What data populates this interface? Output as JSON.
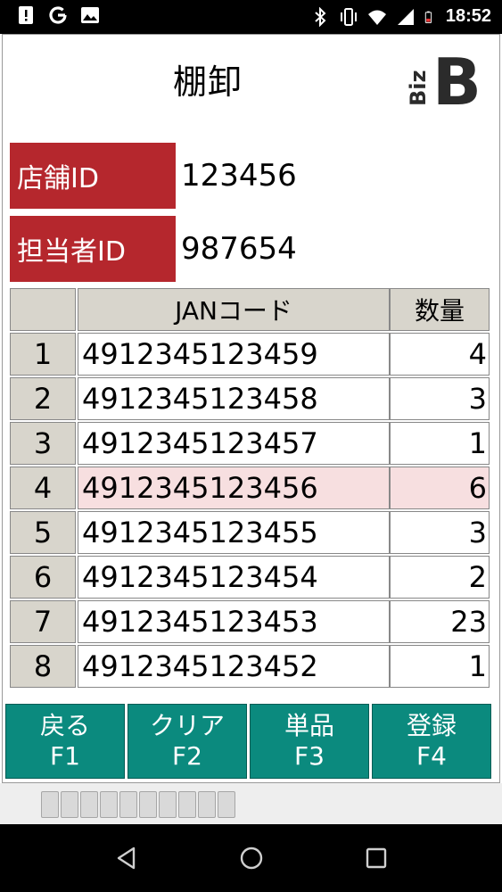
{
  "status_bar": {
    "time": "18:52",
    "left_icons": [
      "alert-icon",
      "google-icon",
      "image-icon"
    ],
    "right_icons": [
      "bluetooth-icon",
      "vibrate-icon",
      "wifi-icon",
      "signal-icon",
      "battery-icon"
    ]
  },
  "header": {
    "title": "棚卸",
    "logo_text": "Biz",
    "logo_letter": "B"
  },
  "fields": {
    "store_label": "店舗ID",
    "store_value": "123456",
    "staff_label": "担当者ID",
    "staff_value": "987654"
  },
  "table": {
    "columns": [
      "",
      "JANコード",
      "数量"
    ],
    "selected_row": 4,
    "rows": [
      {
        "no": "1",
        "jan": "4912345123459",
        "qty": "4"
      },
      {
        "no": "2",
        "jan": "4912345123458",
        "qty": "3"
      },
      {
        "no": "3",
        "jan": "4912345123457",
        "qty": "1"
      },
      {
        "no": "4",
        "jan": "4912345123456",
        "qty": "6"
      },
      {
        "no": "5",
        "jan": "4912345123455",
        "qty": "3"
      },
      {
        "no": "6",
        "jan": "4912345123454",
        "qty": "2"
      },
      {
        "no": "7",
        "jan": "4912345123453",
        "qty": "23"
      },
      {
        "no": "8",
        "jan": "4912345123452",
        "qty": "1"
      }
    ]
  },
  "buttons": [
    {
      "label": "戻る",
      "key": "F1"
    },
    {
      "label": "クリア",
      "key": "F2"
    },
    {
      "label": "単品",
      "key": "F3"
    },
    {
      "label": "登録",
      "key": "F4"
    }
  ],
  "colors": {
    "label_red": "#b5272d",
    "button_teal": "#0b8a7e",
    "header_gray": "#d8d5cc",
    "selected_row": "#f7dfe0"
  },
  "nav": [
    "back-icon",
    "home-icon",
    "recents-icon"
  ]
}
